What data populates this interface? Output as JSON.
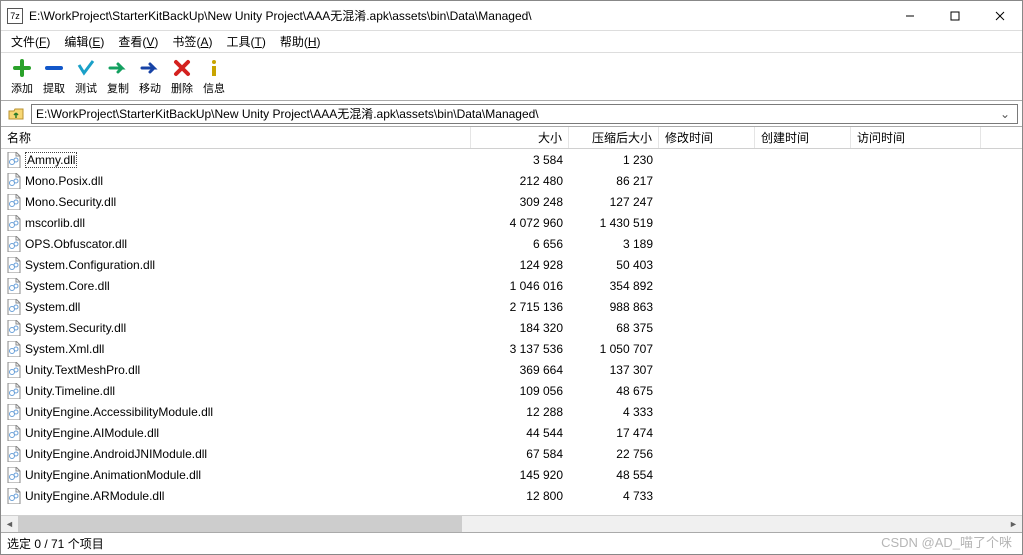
{
  "window": {
    "title": "E:\\WorkProject\\StarterKitBackUp\\New Unity Project\\AAA无混淆.apk\\assets\\bin\\Data\\Managed\\",
    "app_icon_label": "7z"
  },
  "menus": {
    "file": {
      "label": "文件",
      "key": "F"
    },
    "edit": {
      "label": "编辑",
      "key": "E"
    },
    "view": {
      "label": "查看",
      "key": "V"
    },
    "bookmark": {
      "label": "书签",
      "key": "A"
    },
    "tools": {
      "label": "工具",
      "key": "T"
    },
    "help": {
      "label": "帮助",
      "key": "H"
    }
  },
  "toolbar": {
    "add": "添加",
    "extract": "提取",
    "test": "测试",
    "copy": "复制",
    "move": "移动",
    "delete": "删除",
    "info": "信息"
  },
  "path": "E:\\WorkProject\\StarterKitBackUp\\New Unity Project\\AAA无混淆.apk\\assets\\bin\\Data\\Managed\\",
  "columns": {
    "name": "名称",
    "size": "大小",
    "packed": "压缩后大小",
    "modified": "修改时间",
    "created": "创建时间",
    "accessed": "访问时间"
  },
  "files": [
    {
      "name": "Ammy.dll",
      "size": "3 584",
      "packed": "1 230",
      "selected": true
    },
    {
      "name": "Mono.Posix.dll",
      "size": "212 480",
      "packed": "86 217"
    },
    {
      "name": "Mono.Security.dll",
      "size": "309 248",
      "packed": "127 247"
    },
    {
      "name": "mscorlib.dll",
      "size": "4 072 960",
      "packed": "1 430 519"
    },
    {
      "name": "OPS.Obfuscator.dll",
      "size": "6 656",
      "packed": "3 189"
    },
    {
      "name": "System.Configuration.dll",
      "size": "124 928",
      "packed": "50 403"
    },
    {
      "name": "System.Core.dll",
      "size": "1 046 016",
      "packed": "354 892"
    },
    {
      "name": "System.dll",
      "size": "2 715 136",
      "packed": "988 863"
    },
    {
      "name": "System.Security.dll",
      "size": "184 320",
      "packed": "68 375"
    },
    {
      "name": "System.Xml.dll",
      "size": "3 137 536",
      "packed": "1 050 707"
    },
    {
      "name": "Unity.TextMeshPro.dll",
      "size": "369 664",
      "packed": "137 307"
    },
    {
      "name": "Unity.Timeline.dll",
      "size": "109 056",
      "packed": "48 675"
    },
    {
      "name": "UnityEngine.AccessibilityModule.dll",
      "size": "12 288",
      "packed": "4 333"
    },
    {
      "name": "UnityEngine.AIModule.dll",
      "size": "44 544",
      "packed": "17 474"
    },
    {
      "name": "UnityEngine.AndroidJNIModule.dll",
      "size": "67 584",
      "packed": "22 756"
    },
    {
      "name": "UnityEngine.AnimationModule.dll",
      "size": "145 920",
      "packed": "48 554"
    },
    {
      "name": "UnityEngine.ARModule.dll",
      "size": "12 800",
      "packed": "4 733"
    }
  ],
  "status": "选定 0 / 71 个项目",
  "watermark": "CSDN @AD_喵了个咪"
}
